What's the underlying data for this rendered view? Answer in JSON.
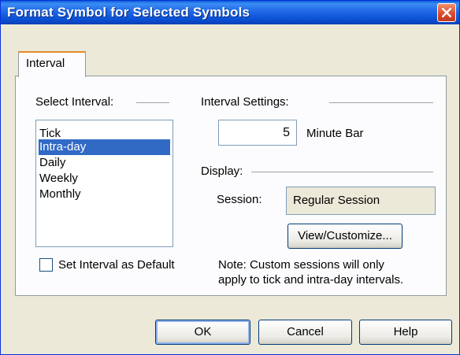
{
  "window": {
    "title": "Format Symbol for Selected Symbols"
  },
  "tabs": [
    {
      "label": "Interval"
    }
  ],
  "select_interval": {
    "heading": "Select Interval:",
    "items": [
      "Tick",
      "Intra-day",
      "Daily",
      "Weekly",
      "Monthly"
    ],
    "selected": "Intra-day"
  },
  "interval_settings": {
    "heading": "Interval Settings:",
    "value": "5",
    "unit_label": "Minute Bar"
  },
  "display": {
    "heading": "Display:",
    "session_label": "Session:",
    "session_value": "Regular Session",
    "customize_button": "View/Customize..."
  },
  "default_checkbox": {
    "label": "Set Interval as Default",
    "checked": false
  },
  "note": {
    "line1": "Note: Custom sessions will only",
    "line2": "apply to tick and intra-day intervals."
  },
  "buttons": {
    "ok": "OK",
    "cancel": "Cancel",
    "help": "Help"
  },
  "colors": {
    "titlebar": "#0a4fd2",
    "selection": "#316ac5",
    "tab_accent": "#e68b2c",
    "close_button": "#d7482a"
  }
}
